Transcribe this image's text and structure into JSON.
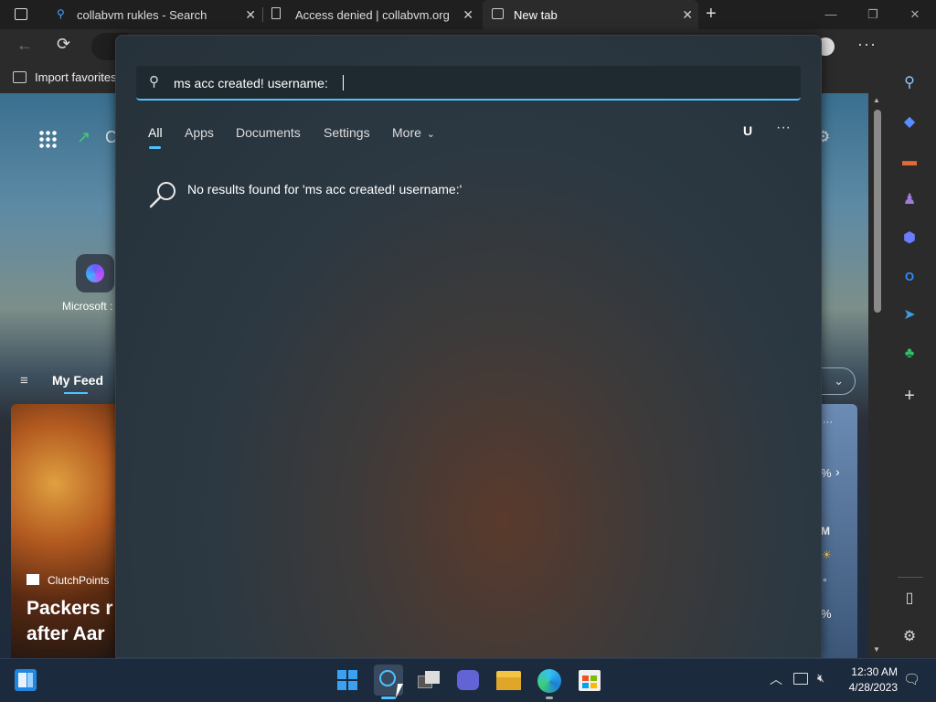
{
  "browser": {
    "tabs": [
      {
        "title": "collabvm rukles - Search",
        "active": false
      },
      {
        "title": "Access denied | collabvm.org use",
        "active": false
      },
      {
        "title": "New tab",
        "active": true
      }
    ],
    "favorites_bar": {
      "import_label": "Import favorites"
    }
  },
  "page": {
    "app_letter": "C",
    "shortcut_label": "Microsoft :",
    "feed_tab": "My Feed",
    "news_source": "ClutchPoints",
    "news_headline_line1": "Packers r",
    "news_headline_line2": "after Aar",
    "weather_pct1": "%",
    "weather_m": "M",
    "weather_deg": "°",
    "weather_pct2": "%"
  },
  "search": {
    "query": "ms acc created! username:",
    "tabs": [
      "All",
      "Apps",
      "Documents",
      "Settings",
      "More"
    ],
    "active_tab": "All",
    "user_initial": "U",
    "no_results_text": "No results found for 'ms acc created! username:'"
  },
  "tray": {
    "time": "12:30 AM",
    "date": "4/28/2023"
  },
  "colors": {
    "accent": "#4cc2ff",
    "taskbar": "#1c2a3d"
  }
}
